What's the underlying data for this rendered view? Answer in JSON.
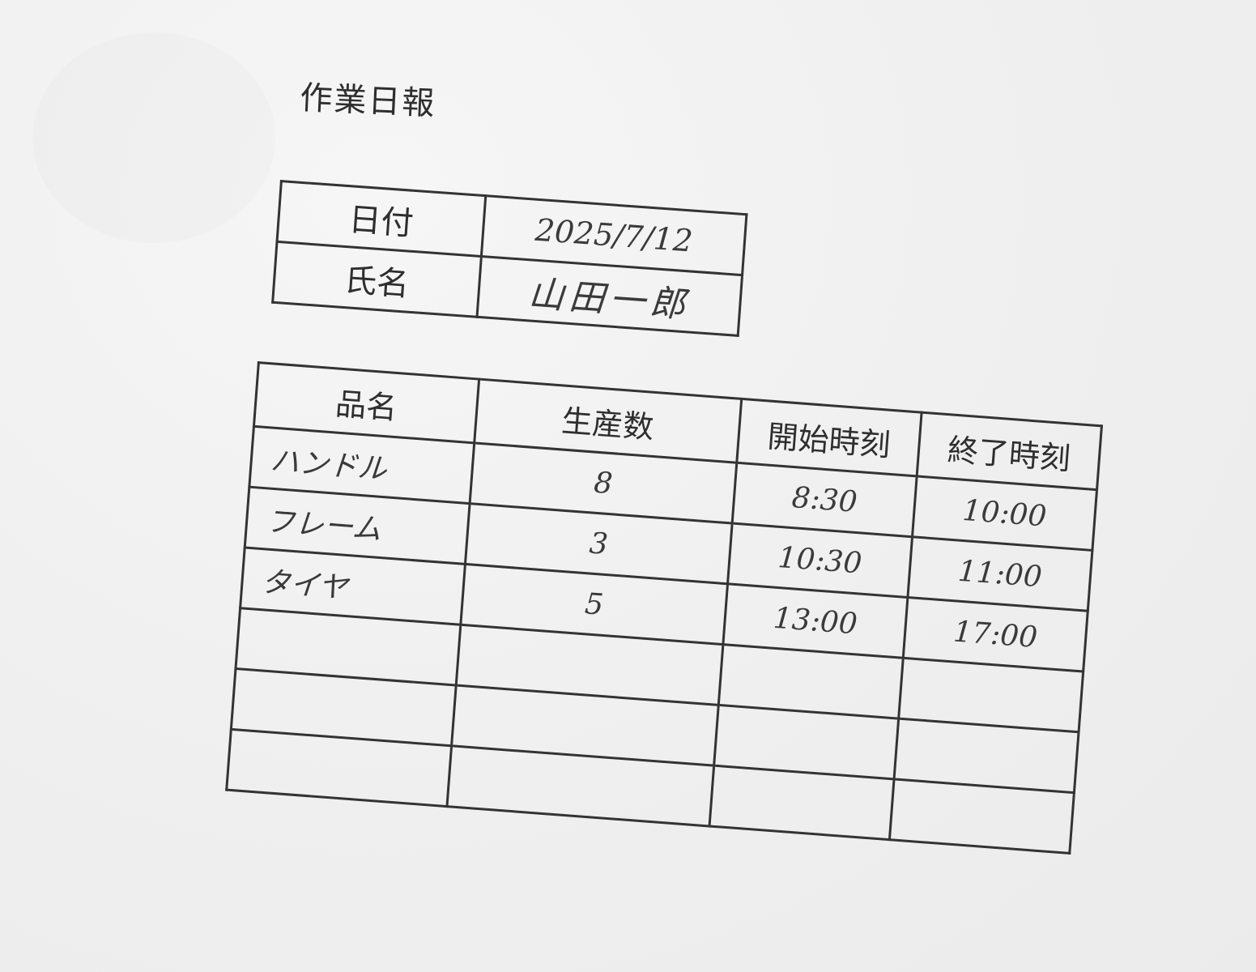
{
  "title": "作業日報",
  "info": {
    "date_label": "日付",
    "date_value": "2025/7/12",
    "name_label": "氏名",
    "name_value": "山田一郎"
  },
  "table": {
    "headers": {
      "item": "品名",
      "quantity": "生産数",
      "start": "開始時刻",
      "end": "終了時刻"
    },
    "rows": [
      {
        "item": "ハンドル",
        "quantity": "8",
        "start": "8:30",
        "end": "10:00"
      },
      {
        "item": "フレーム",
        "quantity": "3",
        "start": "10:30",
        "end": "11:00"
      },
      {
        "item": "タイヤ",
        "quantity": "5",
        "start": "13:00",
        "end": "17:00"
      },
      {
        "item": "",
        "quantity": "",
        "start": "",
        "end": ""
      },
      {
        "item": "",
        "quantity": "",
        "start": "",
        "end": ""
      },
      {
        "item": "",
        "quantity": "",
        "start": "",
        "end": ""
      }
    ]
  }
}
